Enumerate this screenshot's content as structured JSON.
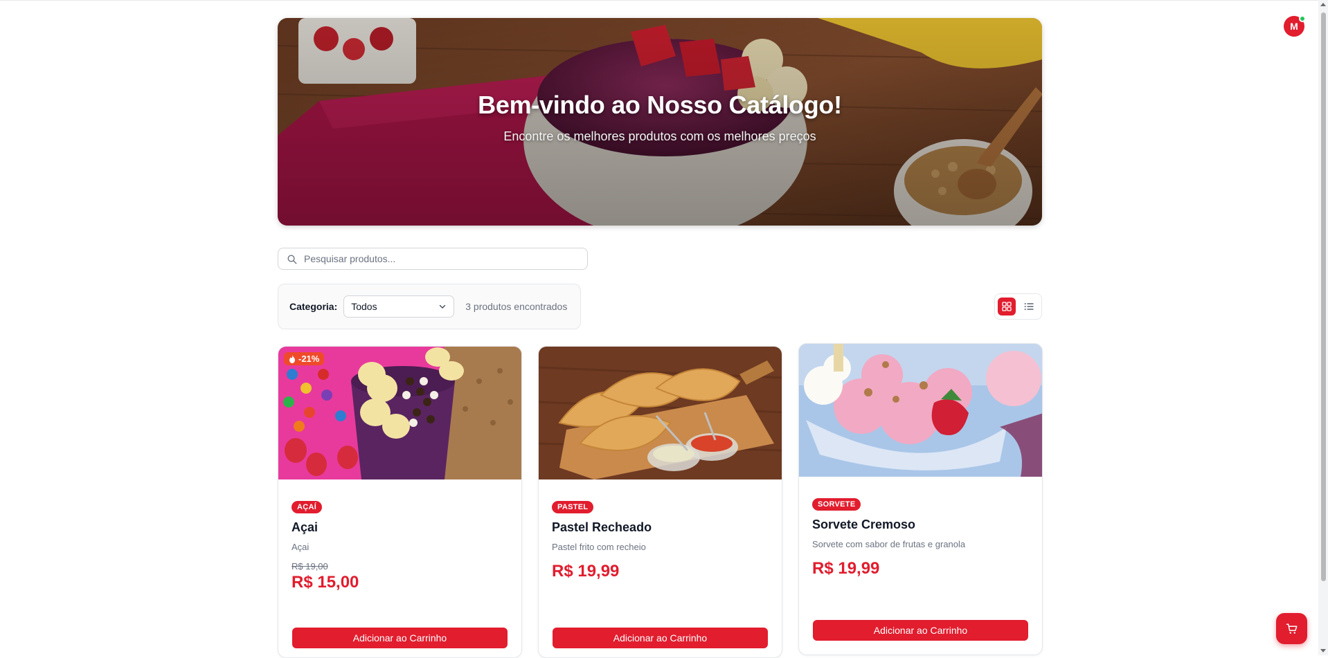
{
  "hero": {
    "title": "Bem-vindo ao Nosso Catálogo!",
    "subtitle": "Encontre os melhores produtos com os melhores preços"
  },
  "user": {
    "initial": "M",
    "online": true
  },
  "search": {
    "placeholder": "Pesquisar produtos..."
  },
  "filter": {
    "label": "Categoria:",
    "selected": "Todos",
    "count_text": "3 produtos encontrados"
  },
  "view": {
    "active": "grid"
  },
  "products": [
    {
      "discount": "-21%",
      "category": "AÇAÍ",
      "name": "Açai",
      "description": "Açai",
      "old_price": "R$ 19,00",
      "price": "R$ 15,00",
      "button": "Adicionar ao Carrinho"
    },
    {
      "category": "PASTEL",
      "name": "Pastel Recheado",
      "description": "Pastel frito com recheio",
      "price": "R$ 19,99",
      "button": "Adicionar ao Carrinho"
    },
    {
      "category": "SORVETE",
      "name": "Sorvete Cremoso",
      "description": "Sorvete com sabor de frutas e granola",
      "price": "R$ 19,99",
      "button": "Adicionar ao Carrinho"
    }
  ],
  "colors": {
    "accent": "#e11d2e",
    "discount": "#ef4b2a",
    "online": "#22c55e"
  }
}
